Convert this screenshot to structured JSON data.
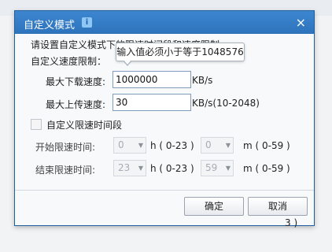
{
  "dialog": {
    "title": "自定义模式",
    "close_symbol": "×",
    "info_symbol": "i",
    "prompt": "请设置自定义模式下的限速时间段和速度限制",
    "speed_limit_label": "自定义速度限制：",
    "tooltip": "输入值必须小于等于1048576",
    "download": {
      "label": "最大下载速度:",
      "value": "1000000",
      "unit": "KB/s"
    },
    "upload": {
      "label": "最大上传速度:",
      "value": "30",
      "unit": "KB/s(10-2048)"
    },
    "time_period_label": "自定义限速时间段",
    "start": {
      "label": "开始限速时间:",
      "hour": "0",
      "hour_unit": "h ( 0-23 )",
      "minute": "0",
      "minute_unit": "m ( 0-59 )"
    },
    "end": {
      "label": "结束限速时间:",
      "hour": "23",
      "hour_unit": "h ( 0-23 )",
      "minute": "59",
      "minute_unit": "m ( 0-59 )"
    },
    "ok_label": "确定",
    "cancel_label": "取消"
  },
  "corner_text": "3 )"
}
